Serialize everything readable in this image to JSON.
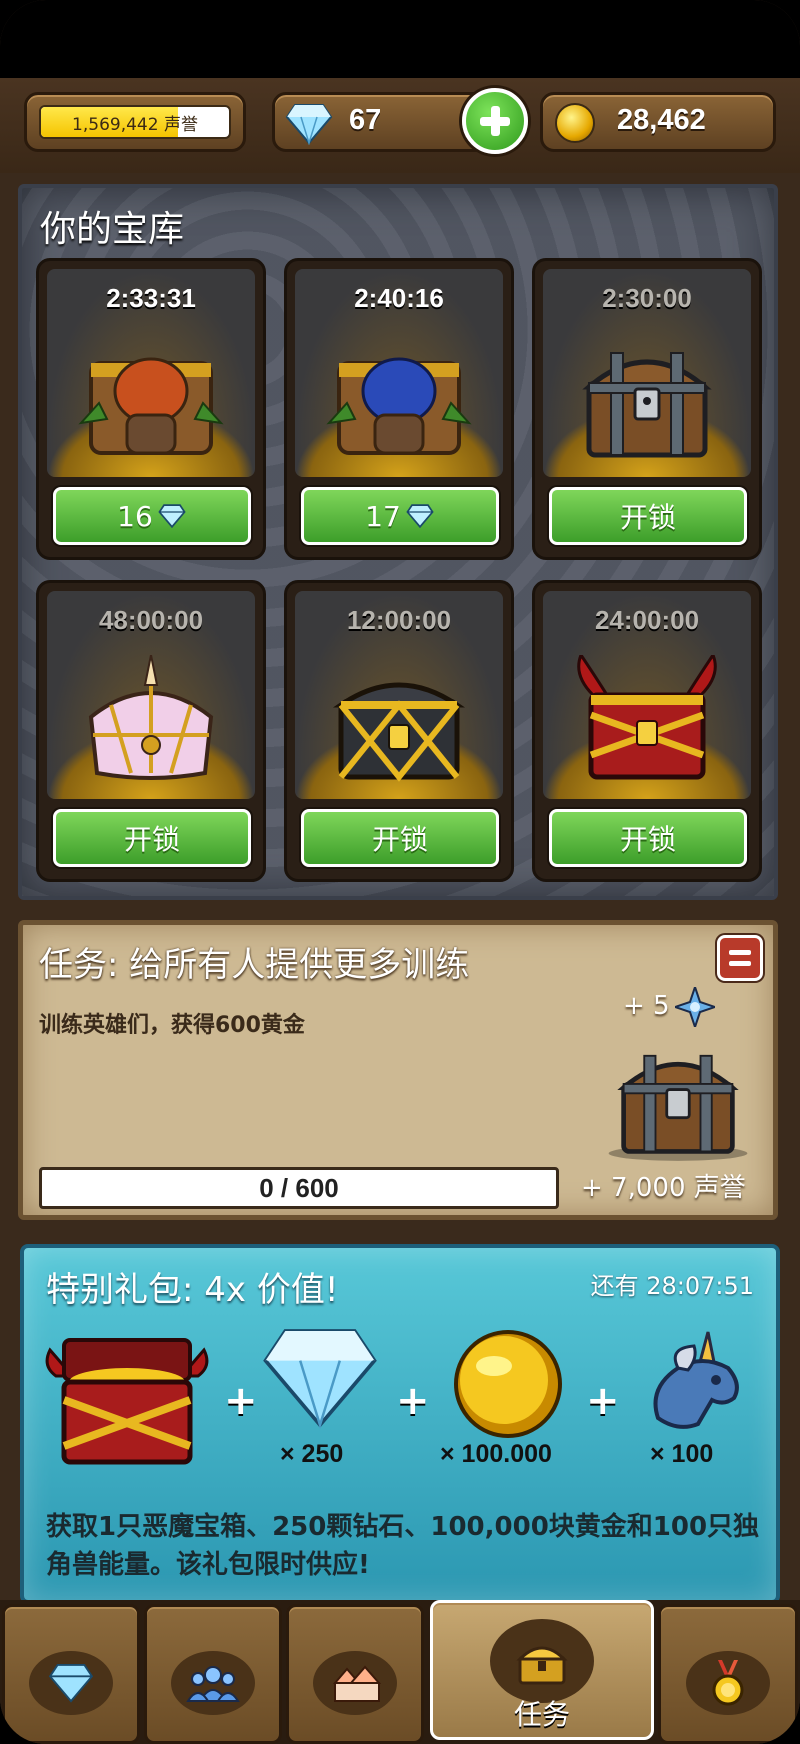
{
  "resources": {
    "prestige": "1,569,442 声誉",
    "prestige_fill": 0.73,
    "gems": "67",
    "gold": "28,462"
  },
  "vault": {
    "title": "你的宝库",
    "slots": [
      {
        "timer": "2:33:31",
        "button": "16",
        "button_icon": "diamond-icon",
        "chest": "goblin-chest"
      },
      {
        "timer": "2:40:16",
        "button": "17",
        "button_icon": "diamond-icon",
        "chest": "goblin-blue-chest"
      },
      {
        "timer": "2:30:00",
        "button": "开锁",
        "chest": "iron-chest"
      },
      {
        "timer": "48:00:00",
        "button": "开锁",
        "chest": "unicorn-chest"
      },
      {
        "timer": "12:00:00",
        "button": "开锁",
        "chest": "gold-lattice-chest"
      },
      {
        "timer": "24:00:00",
        "button": "开锁",
        "chest": "demon-chest"
      }
    ]
  },
  "quest": {
    "title": "任务: 给所有人提供更多训练",
    "description": "训练英雄们，获得600黄金",
    "reward_gems": "+ 5",
    "progress": "0 / 600",
    "progress_value": 0,
    "reward_prestige": "+ 7,000 声誉"
  },
  "offer": {
    "title": "特别礼包: 4x 价值!",
    "timer": "还有 28:07:51",
    "items": [
      {
        "icon": "demon-chest-icon",
        "qty": ""
      },
      {
        "icon": "diamond-icon",
        "qty": "× 250"
      },
      {
        "icon": "gold-coin-icon",
        "qty": "× 100.000"
      },
      {
        "icon": "unicorn-icon",
        "qty": "× 100"
      }
    ],
    "description": "获取1只恶魔宝箱、250颗钻石、100,000块黄金和100只独角兽能量。该礼包限时供应!"
  },
  "nav": {
    "tabs": [
      {
        "icon": "diamond-icon",
        "label": ""
      },
      {
        "icon": "heroes-icon",
        "label": ""
      },
      {
        "icon": "buildings-icon",
        "label": ""
      },
      {
        "icon": "chest-icon",
        "label": "任务",
        "active": true
      },
      {
        "icon": "medal-icon",
        "label": ""
      }
    ]
  },
  "colors": {
    "button_green": "#4caf35",
    "offer_teal": "#3fb0c6",
    "parchment": "#cdb993"
  }
}
